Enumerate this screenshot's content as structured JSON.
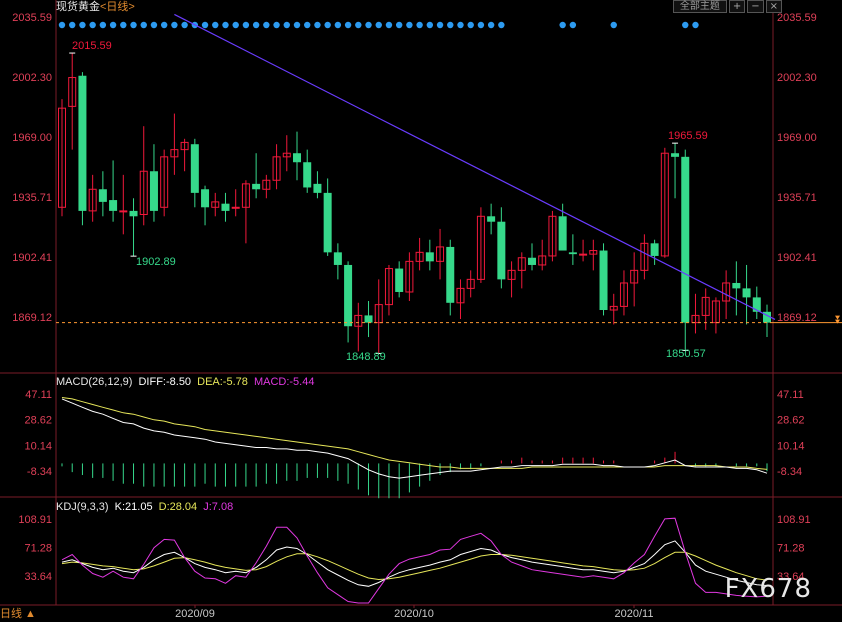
{
  "header": {
    "symbol": "现货黄金",
    "period_btn": "<日线>",
    "main_btn": "全部主题",
    "btn_zoom_in": "+",
    "btn_zoom_out": "−",
    "btn_close": "×"
  },
  "price_axis": {
    "labels": [
      "2035.59",
      "2002.30",
      "1969.00",
      "1935.71",
      "1902.41",
      "1869.12"
    ]
  },
  "annotations": {
    "high1": "2015.59",
    "low1": "1902.89",
    "low2": "1848.89",
    "high2": "1965.59",
    "low3": "1850.57"
  },
  "macd": {
    "label": "MACD(26,12,9)",
    "diff": "DIFF:-8.50",
    "dea": "DEA:-5.78",
    "macd": "MACD:-5.44",
    "axis": [
      "47.11",
      "28.62",
      "10.14",
      "-8.34"
    ]
  },
  "kdj": {
    "label": "KDJ(9,3,3)",
    "k": "K:21.05",
    "d": "D:28.04",
    "j": "J:7.08",
    "axis": [
      "108.91",
      "71.28",
      "33.64"
    ]
  },
  "time_axis": [
    "2020/09",
    "2020/10",
    "2020/11"
  ],
  "footer": {
    "period_label": "日线 ▲",
    "logo": "FX678"
  },
  "colors": {
    "up": "#f1193b",
    "down": "#36d98b",
    "trendline": "#6a3cff",
    "current_price_line": "#ff9933",
    "diff_line": "#ffffff",
    "dea_line": "#e6e65a",
    "k_line": "#ffffff",
    "d_line": "#e6e65a",
    "j_line": "#e038e0",
    "event_dot": "#2d9bf0",
    "axis_text": "#e04058"
  },
  "chart_data": [
    {
      "type": "candlestick",
      "title": "现货黄金",
      "ylim": [
        1840,
        2040
      ],
      "x_labels": [
        "2020/09",
        "2020/10",
        "2020/11"
      ],
      "candles": [
        {
          "o": 1930,
          "h": 1990,
          "l": 1925,
          "c": 1985
        },
        {
          "o": 1986,
          "h": 2015.59,
          "l": 1962,
          "c": 2002
        },
        {
          "o": 2003,
          "h": 2005,
          "l": 1920,
          "c": 1928
        },
        {
          "o": 1928,
          "h": 1948,
          "l": 1922,
          "c": 1940
        },
        {
          "o": 1940,
          "h": 1950,
          "l": 1925,
          "c": 1933
        },
        {
          "o": 1934,
          "h": 1956,
          "l": 1922,
          "c": 1928
        },
        {
          "o": 1928,
          "h": 1948,
          "l": 1915,
          "c": 1928
        },
        {
          "o": 1928,
          "h": 1935,
          "l": 1902.89,
          "c": 1925
        },
        {
          "o": 1926,
          "h": 1975,
          "l": 1920,
          "c": 1950
        },
        {
          "o": 1950,
          "h": 1965,
          "l": 1922,
          "c": 1928
        },
        {
          "o": 1930,
          "h": 1962,
          "l": 1925,
          "c": 1958
        },
        {
          "o": 1958,
          "h": 1982,
          "l": 1948,
          "c": 1962
        },
        {
          "o": 1962,
          "h": 1968,
          "l": 1950,
          "c": 1966
        },
        {
          "o": 1965,
          "h": 1968,
          "l": 1930,
          "c": 1938
        },
        {
          "o": 1940,
          "h": 1942,
          "l": 1920,
          "c": 1930
        },
        {
          "o": 1930,
          "h": 1938,
          "l": 1925,
          "c": 1933
        },
        {
          "o": 1932,
          "h": 1938,
          "l": 1922,
          "c": 1928
        },
        {
          "o": 1930,
          "h": 1940,
          "l": 1925,
          "c": 1930
        },
        {
          "o": 1930,
          "h": 1945,
          "l": 1910,
          "c": 1943
        },
        {
          "o": 1943,
          "h": 1960,
          "l": 1935,
          "c": 1940
        },
        {
          "o": 1940,
          "h": 1948,
          "l": 1935,
          "c": 1945
        },
        {
          "o": 1945,
          "h": 1965,
          "l": 1940,
          "c": 1958
        },
        {
          "o": 1958,
          "h": 1970,
          "l": 1950,
          "c": 1960
        },
        {
          "o": 1960,
          "h": 1972,
          "l": 1945,
          "c": 1955
        },
        {
          "o": 1955,
          "h": 1962,
          "l": 1938,
          "c": 1941
        },
        {
          "o": 1943,
          "h": 1950,
          "l": 1935,
          "c": 1938
        },
        {
          "o": 1938,
          "h": 1946,
          "l": 1903,
          "c": 1905
        },
        {
          "o": 1905,
          "h": 1910,
          "l": 1890,
          "c": 1898
        },
        {
          "o": 1898,
          "h": 1900,
          "l": 1855,
          "c": 1864
        },
        {
          "o": 1864,
          "h": 1877,
          "l": 1850,
          "c": 1870
        },
        {
          "o": 1870,
          "h": 1878,
          "l": 1858,
          "c": 1866
        },
        {
          "o": 1866,
          "h": 1890,
          "l": 1848.89,
          "c": 1876
        },
        {
          "o": 1876,
          "h": 1898,
          "l": 1870,
          "c": 1896
        },
        {
          "o": 1896,
          "h": 1900,
          "l": 1880,
          "c": 1883
        },
        {
          "o": 1883,
          "h": 1905,
          "l": 1878,
          "c": 1900
        },
        {
          "o": 1900,
          "h": 1913,
          "l": 1895,
          "c": 1905
        },
        {
          "o": 1905,
          "h": 1912,
          "l": 1895,
          "c": 1900
        },
        {
          "o": 1900,
          "h": 1918,
          "l": 1890,
          "c": 1908
        },
        {
          "o": 1908,
          "h": 1912,
          "l": 1870,
          "c": 1877
        },
        {
          "o": 1877,
          "h": 1890,
          "l": 1868,
          "c": 1885
        },
        {
          "o": 1885,
          "h": 1895,
          "l": 1880,
          "c": 1890
        },
        {
          "o": 1890,
          "h": 1930,
          "l": 1888,
          "c": 1925
        },
        {
          "o": 1925,
          "h": 1932,
          "l": 1915,
          "c": 1922
        },
        {
          "o": 1922,
          "h": 1930,
          "l": 1885,
          "c": 1890
        },
        {
          "o": 1890,
          "h": 1900,
          "l": 1880,
          "c": 1895
        },
        {
          "o": 1895,
          "h": 1905,
          "l": 1885,
          "c": 1902
        },
        {
          "o": 1902,
          "h": 1910,
          "l": 1895,
          "c": 1898
        },
        {
          "o": 1898,
          "h": 1912,
          "l": 1895,
          "c": 1903
        },
        {
          "o": 1903,
          "h": 1928,
          "l": 1900,
          "c": 1925
        },
        {
          "o": 1925,
          "h": 1932,
          "l": 1920,
          "c": 1906
        },
        {
          "o": 1905,
          "h": 1915,
          "l": 1898,
          "c": 1904
        },
        {
          "o": 1904,
          "h": 1912,
          "l": 1900,
          "c": 1904
        },
        {
          "o": 1904,
          "h": 1912,
          "l": 1895,
          "c": 1906
        },
        {
          "o": 1906,
          "h": 1910,
          "l": 1870,
          "c": 1873
        },
        {
          "o": 1873,
          "h": 1882,
          "l": 1865,
          "c": 1875
        },
        {
          "o": 1875,
          "h": 1895,
          "l": 1870,
          "c": 1888
        },
        {
          "o": 1888,
          "h": 1905,
          "l": 1875,
          "c": 1895
        },
        {
          "o": 1895,
          "h": 1915,
          "l": 1890,
          "c": 1910
        },
        {
          "o": 1910,
          "h": 1912,
          "l": 1898,
          "c": 1903
        },
        {
          "o": 1903,
          "h": 1963,
          "l": 1902,
          "c": 1960
        },
        {
          "o": 1960,
          "h": 1965.59,
          "l": 1935,
          "c": 1958
        },
        {
          "o": 1958,
          "h": 1962,
          "l": 1850.57,
          "c": 1866
        },
        {
          "o": 1866,
          "h": 1882,
          "l": 1860,
          "c": 1870
        },
        {
          "o": 1870,
          "h": 1885,
          "l": 1862,
          "c": 1880
        },
        {
          "o": 1866,
          "h": 1880,
          "l": 1860,
          "c": 1878
        },
        {
          "o": 1878,
          "h": 1895,
          "l": 1868,
          "c": 1888
        },
        {
          "o": 1888,
          "h": 1900,
          "l": 1870,
          "c": 1885
        },
        {
          "o": 1885,
          "h": 1898,
          "l": 1865,
          "c": 1880
        },
        {
          "o": 1880,
          "h": 1886,
          "l": 1868,
          "c": 1872
        },
        {
          "o": 1872,
          "h": 1876,
          "l": 1858,
          "c": 1866
        }
      ],
      "trendline": [
        {
          "i": 11,
          "price": 2037
        },
        {
          "i": 69,
          "price": 1870
        }
      ],
      "current_price": 1866,
      "event_dots_index": [
        0,
        1,
        2,
        3,
        4,
        5,
        6,
        7,
        8,
        9,
        10,
        11,
        12,
        13,
        14,
        15,
        16,
        17,
        18,
        19,
        20,
        21,
        22,
        23,
        24,
        25,
        26,
        27,
        28,
        29,
        30,
        31,
        32,
        33,
        34,
        35,
        36,
        37,
        38,
        39,
        40,
        41,
        42,
        43,
        49,
        50,
        54,
        61,
        62
      ]
    },
    {
      "type": "bar+line",
      "title": "MACD(26,12,9)",
      "ylim": [
        -20,
        50
      ],
      "series": [
        {
          "name": "DIFF",
          "values": [
            45,
            42,
            39,
            36,
            34,
            31,
            28,
            27,
            24,
            22,
            21,
            19,
            18,
            17,
            16,
            14,
            13,
            12,
            11,
            10,
            10,
            9,
            9,
            8,
            8,
            7,
            6,
            4,
            2,
            -2,
            -6,
            -9,
            -11,
            -12,
            -11,
            -10,
            -9,
            -8,
            -7,
            -7,
            -7,
            -6,
            -5,
            -4,
            -4,
            -3,
            -3,
            -3,
            -3,
            -2,
            -2,
            -2,
            -2,
            -3,
            -3,
            -4,
            -4,
            -4,
            -3,
            -1,
            1,
            -3,
            -4,
            -4,
            -4,
            -4,
            -5,
            -5,
            -6,
            -8.5
          ]
        },
        {
          "name": "DEA",
          "values": [
            46,
            45,
            43,
            41,
            39,
            37,
            35,
            34,
            32,
            30,
            29,
            27,
            26,
            25,
            23,
            22,
            21,
            20,
            19,
            18,
            17,
            16,
            15,
            14,
            13,
            12,
            11,
            10,
            9,
            7,
            5,
            3,
            1,
            0,
            -1,
            -2,
            -3,
            -4,
            -4,
            -5,
            -5,
            -5,
            -5,
            -5,
            -5,
            -5,
            -4,
            -4,
            -4,
            -4,
            -4,
            -4,
            -4,
            -4,
            -4,
            -4,
            -4,
            -4,
            -4,
            -3,
            -3,
            -3,
            -3,
            -3,
            -3,
            -4,
            -4,
            -4,
            -5,
            -5.78
          ]
        },
        {
          "name": "MACD",
          "values": [
            -2,
            -6,
            -8,
            -10,
            -10,
            -12,
            -14,
            -14,
            -16,
            -16,
            -16,
            -16,
            -16,
            -16,
            -14,
            -16,
            -16,
            -16,
            -16,
            -16,
            -14,
            -14,
            -12,
            -12,
            -10,
            -10,
            -10,
            -12,
            -14,
            -18,
            -22,
            -24,
            -24,
            -24,
            -20,
            -16,
            -12,
            -8,
            -6,
            -4,
            -4,
            -2,
            0,
            2,
            2,
            4,
            2,
            2,
            2,
            4,
            4,
            4,
            4,
            2,
            2,
            0,
            0,
            0,
            2,
            4,
            8,
            0,
            -2,
            -2,
            -2,
            0,
            -2,
            -2,
            -2,
            -5.44
          ]
        }
      ]
    },
    {
      "type": "line",
      "title": "KDJ(9,3,3)",
      "ylim": [
        0,
        115
      ],
      "series": [
        {
          "name": "K",
          "values": [
            52,
            55,
            50,
            45,
            42,
            44,
            40,
            38,
            45,
            55,
            62,
            65,
            58,
            50,
            45,
            42,
            38,
            40,
            38,
            45,
            55,
            68,
            72,
            70,
            62,
            52,
            42,
            35,
            28,
            22,
            20,
            25,
            32,
            38,
            42,
            45,
            48,
            52,
            55,
            62,
            66,
            70,
            68,
            62,
            58,
            55,
            52,
            50,
            48,
            46,
            44,
            42,
            42,
            40,
            38,
            40,
            45,
            50,
            62,
            75,
            80,
            65,
            48,
            40,
            36,
            32,
            28,
            25,
            22,
            21.05
          ]
        },
        {
          "name": "D",
          "values": [
            50,
            52,
            51,
            49,
            47,
            46,
            44,
            42,
            43,
            47,
            52,
            57,
            58,
            55,
            52,
            48,
            45,
            43,
            41,
            42,
            46,
            53,
            59,
            63,
            63,
            59,
            54,
            48,
            42,
            36,
            31,
            29,
            30,
            32,
            35,
            38,
            41,
            44,
            48,
            52,
            56,
            60,
            62,
            62,
            61,
            59,
            57,
            55,
            53,
            51,
            49,
            47,
            46,
            44,
            42,
            41,
            42,
            44,
            50,
            58,
            65,
            65,
            60,
            54,
            48,
            43,
            38,
            34,
            30,
            28.04
          ]
        },
        {
          "name": "J",
          "values": [
            55,
            62,
            48,
            37,
            32,
            40,
            32,
            30,
            49,
            71,
            82,
            81,
            58,
            40,
            31,
            30,
            24,
            34,
            32,
            51,
            73,
            98,
            98,
            84,
            60,
            38,
            18,
            9,
            0,
            -5,
            -2,
            17,
            36,
            50,
            56,
            59,
            62,
            68,
            69,
            82,
            86,
            90,
            80,
            62,
            52,
            47,
            42,
            40,
            38,
            36,
            34,
            32,
            34,
            32,
            30,
            38,
            51,
            62,
            86,
            109,
            110,
            65,
            24,
            12,
            12,
            10,
            8,
            7,
            6,
            7.08
          ]
        }
      ]
    }
  ]
}
